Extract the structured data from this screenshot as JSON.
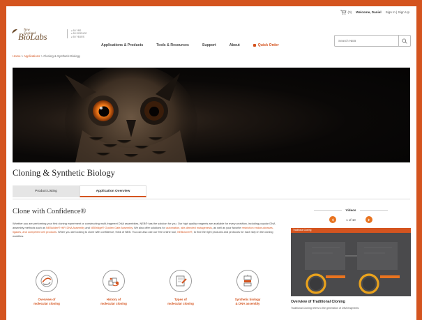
{
  "utility": {
    "cart_count": "(0)",
    "welcome": "Welcome, Daniel",
    "links": "Sign In  |  Sign Up"
  },
  "logo": {
    "line1": "New England",
    "line2": "BioLabs",
    "line3": "Inc.",
    "tagline": [
      "≥ 50 YRS",
      "≥ 50 SCIENCE",
      "≥ 50 YEARS"
    ]
  },
  "nav": {
    "items": [
      "Applications & Products",
      "Tools & Resources",
      "Support",
      "About"
    ],
    "quick_order": "Quick Order"
  },
  "search": {
    "placeholder": "Search NEB"
  },
  "breadcrumb": {
    "home": "Home",
    "sep": " > ",
    "applications": "Applications",
    "current": "Cloning & Synthetic Biology"
  },
  "page_title": "Cloning & Synthetic Biology",
  "tabs": [
    "Product Listing",
    "Application Overview"
  ],
  "section": {
    "title": "Clone with Confidence®",
    "body_parts": [
      {
        "t": "Whether you are performing your first cloning experiment or constructing multi-fragment DNA assemblies, NEB® has the solution for you. Our high quality reagents are available for every workflow, including popular DNA assembly methods such as ",
        "link": false
      },
      {
        "t": "NEBuilder® HiFi DNA Assembly",
        "link": true
      },
      {
        "t": " and ",
        "link": false
      },
      {
        "t": "NEBridge® Golden Gate Assembly",
        "link": true
      },
      {
        "t": ". We also offer solutions for ",
        "link": false
      },
      {
        "t": "automation, site-directed mutagenesis",
        "link": true
      },
      {
        "t": ", as well as your favorite ",
        "link": false
      },
      {
        "t": "restriction endonucleases, ligases, and competent cell products",
        "link": true
      },
      {
        "t": ". When you are looking to clone with confidence, think of NEB. You can also use our free online tool, ",
        "link": false
      },
      {
        "t": "NEBcloner®",
        "link": true
      },
      {
        "t": ", to find the right products and protocols for each step in the cloning workflow.",
        "link": false
      }
    ]
  },
  "cards": [
    {
      "label": "Overview of\nmolecular cloning",
      "icon": "cloning-overview-icon"
    },
    {
      "label": "History of\nmolecular cloning",
      "icon": "cloning-history-icon"
    },
    {
      "label": "Types of\nmolecular cloning",
      "icon": "cloning-types-icon"
    },
    {
      "label": "Synthetic biology\n& DNA assembly",
      "icon": "dna-assembly-icon"
    }
  ],
  "videos": {
    "heading": "Videos",
    "pager": "1 of 10",
    "thumb_title": "Traditional Cloning",
    "caption": "Overview of Traditional Cloning",
    "description": "Traditional Cloning refers to the generation of DNA fragments"
  },
  "colors": {
    "accent": "#d4541f",
    "frame": "#d4541f",
    "icon_gray": "#9a9a9a"
  }
}
